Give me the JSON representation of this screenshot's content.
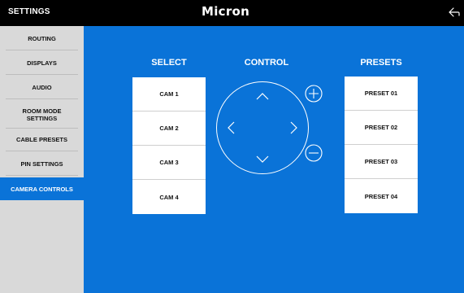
{
  "header": {
    "title": "SETTINGS",
    "logo_text": "Micron"
  },
  "sidebar": {
    "items": [
      {
        "label": "ROUTING"
      },
      {
        "label": "DISPLAYS"
      },
      {
        "label": "AUDIO"
      },
      {
        "label": "ROOM MODE SETTINGS"
      },
      {
        "label": "CABLE PRESETS"
      },
      {
        "label": "PIN SETTINGS"
      },
      {
        "label": "CAMERA CONTROLS"
      }
    ],
    "active_label": "CAMERA CONTROLS"
  },
  "main": {
    "select": {
      "heading": "SELECT",
      "items": [
        "CAM 1",
        "CAM 2",
        "CAM 3",
        "CAM 4"
      ]
    },
    "control": {
      "heading": "CONTROL"
    },
    "presets": {
      "heading": "PRESETS",
      "items": [
        "PRESET 01",
        "PRESET 02",
        "PRESET 03",
        "PRESET 04"
      ]
    }
  },
  "colors": {
    "accent": "#0a73d8",
    "header_bg": "#000000",
    "sidebar_bg": "#d9d9d9"
  },
  "icons": [
    "back-icon",
    "arrow-up-icon",
    "arrow-down-icon",
    "arrow-left-icon",
    "arrow-right-icon",
    "zoom-in-icon",
    "zoom-out-icon"
  ]
}
